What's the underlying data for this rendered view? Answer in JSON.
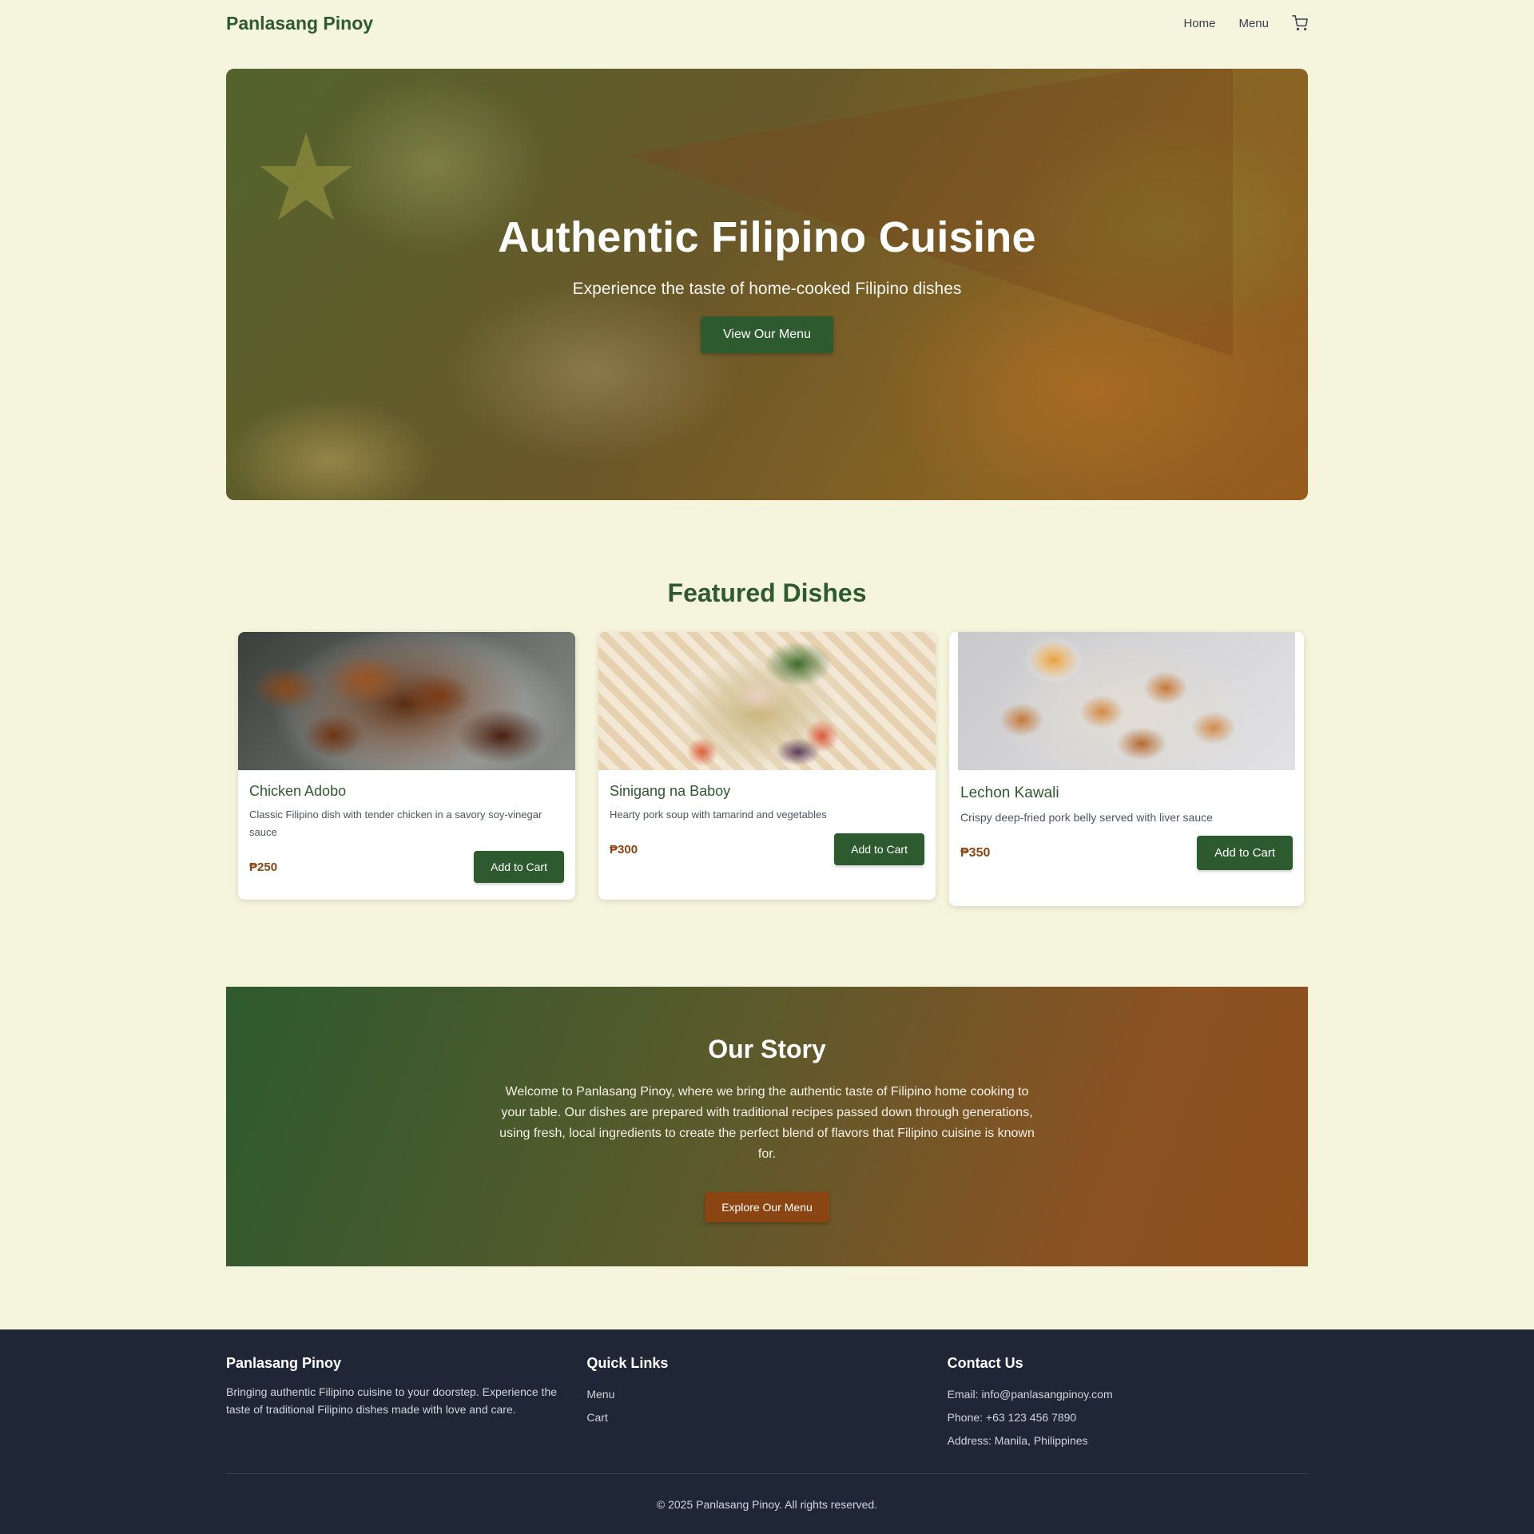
{
  "nav": {
    "brand": "Panlasang Pinoy",
    "links": [
      "Home",
      "Menu"
    ],
    "cart_icon": "cart-icon"
  },
  "hero": {
    "title": "Authentic Filipino Cuisine",
    "subtitle": "Experience the taste of home-cooked Filipino dishes",
    "button": "View Our Menu"
  },
  "featured": {
    "title": "Featured Dishes",
    "dishes": [
      {
        "name": "Chicken Adobo",
        "description": "Classic Filipino dish with tender chicken in a savory soy-vinegar sauce",
        "price": "₱250",
        "button": "Add to Cart"
      },
      {
        "name": "Sinigang na Baboy",
        "description": "Hearty pork soup with tamarind and vegetables",
        "price": "₱300",
        "button": "Add to Cart"
      },
      {
        "name": "Lechon Kawali",
        "description": "Crispy deep-fried pork belly served with liver sauce",
        "price": "₱350",
        "button": "Add to Cart"
      }
    ]
  },
  "story": {
    "title": "Our Story",
    "text": "Welcome to Panlasang Pinoy, where we bring the authentic taste of Filipino home cooking to your table. Our dishes are prepared with traditional recipes passed down through generations, using fresh, local ingredients to create the perfect blend of flavors that Filipino cuisine is known for.",
    "button": "Explore Our Menu"
  },
  "footer": {
    "about_title": "Panlasang Pinoy",
    "about_text": "Bringing authentic Filipino cuisine to your doorstep. Experience the taste of traditional Filipino dishes made with love and care.",
    "links_title": "Quick Links",
    "links": [
      "Menu",
      "Cart"
    ],
    "contact_title": "Contact Us",
    "email": "Email: info@panlasangpinoy.com",
    "phone": "Phone: +63 123 456 7890",
    "address": "Address: Manila, Philippines",
    "copyright": "© 2025 Panlasang Pinoy. All rights reserved."
  },
  "colors": {
    "primary": "#2d5a2e",
    "accent": "#8b4513",
    "background": "#f5f4dc",
    "footer_bg": "#1f2737"
  }
}
